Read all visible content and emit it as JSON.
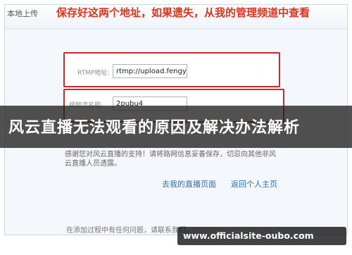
{
  "header": {
    "tab_label": "本地上传",
    "notice": "保存好这两个地址，如果遗失，从我的管理频道中查看"
  },
  "fields": {
    "rtmp_label": "RTMP地址:",
    "rtmp_value": "rtmp://upload.fengyu",
    "stream_label": "视频流名称:",
    "stream_value": "2pubu4"
  },
  "banner": {
    "title": "风云直播无法观看的原因及解决办法解析"
  },
  "help": {
    "text": "感谢您对风云直播的支持！请将路网信息妥善保存，切忌向其他非风云直播人员透露。"
  },
  "links": {
    "go_live_page": "去我的直播页面",
    "back_personal": "返回个人主页"
  },
  "footer": {
    "text": "在添加过程中有任何问题，请联系我们，"
  },
  "watermark": {
    "text": "www.officialsite-oubo.com"
  }
}
